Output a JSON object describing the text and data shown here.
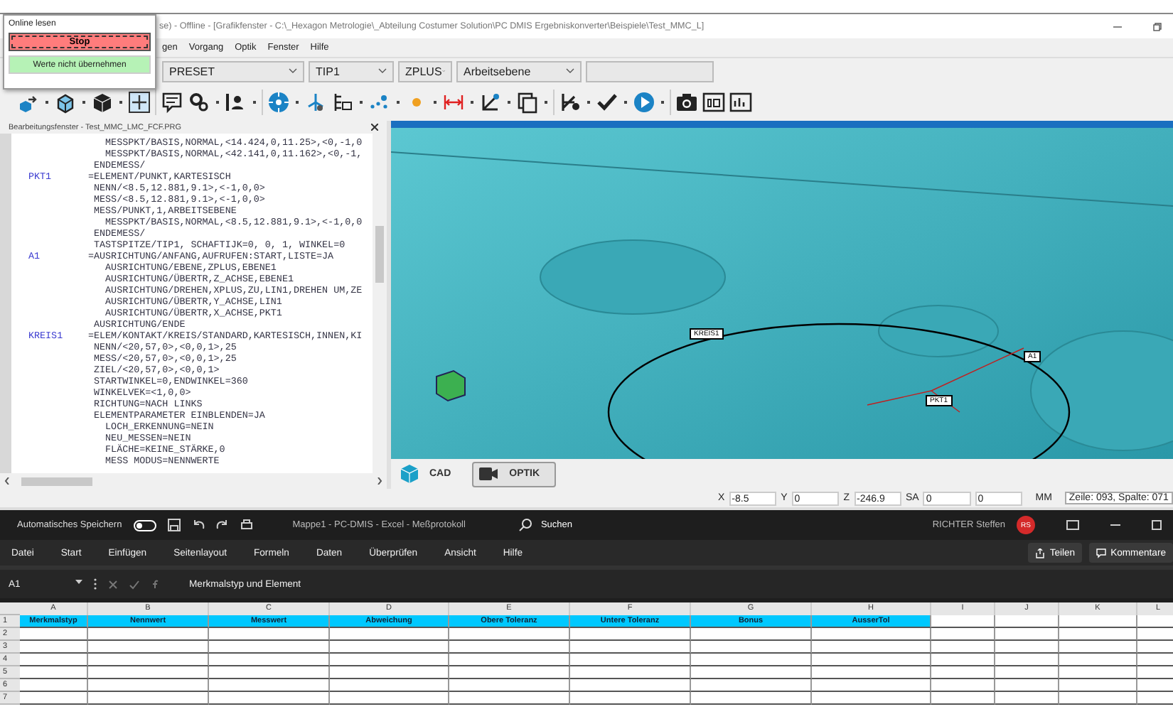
{
  "popup": {
    "label": "Online lesen",
    "stop_button": "Stop",
    "discard_button": "Werte nicht übernehmen"
  },
  "window": {
    "title": "se) - Offline - [Grafikfenster - C:\\_Hexagon Metrologie\\_Abteilung Costumer Solution\\PC DMIS Ergebniskonverter\\Beispiele\\Test_MMC_L]"
  },
  "menu": [
    "gen",
    "Vorgang",
    "Optik",
    "Fenster",
    "Hilfe"
  ],
  "combos": [
    "PRESET",
    "TIP1",
    "ZPLUS",
    "Arbeitsebene"
  ],
  "editor": {
    "title": "Bearbeitungsfenster - Test_MMC_LMC_FCF.PRG",
    "lines": [
      {
        "code": "   MESSPKT/BASIS,NORMAL,<14.424,0,11.25>,<0,-1,0"
      },
      {
        "code": "   MESSPKT/BASIS,NORMAL,<42.141,0,11.162>,<0,-1,"
      },
      {
        "code": " ENDEMESS/"
      },
      {
        "label": "PKT1",
        "code": "=ELEMENT/PUNKT,KARTESISCH"
      },
      {
        "code": " NENN/<8.5,12.881,9.1>,<-1,0,0>"
      },
      {
        "code": " MESS/<8.5,12.881,9.1>,<-1,0,0>"
      },
      {
        "code": " MESS/PUNKT,1,ARBEITSEBENE"
      },
      {
        "code": "   MESSPKT/BASIS,NORMAL,<8.5,12.881,9.1>,<-1,0,0"
      },
      {
        "code": " ENDEMESS/"
      },
      {
        "code": " TASTSPITZE/TIP1, SCHAFTIJK=0, 0, 1, WINKEL=0"
      },
      {
        "label": "A1",
        "code": "=AUSRICHTUNG/ANFANG,AUFRUFEN:START,LISTE=JA"
      },
      {
        "code": "   AUSRICHTUNG/EBENE,ZPLUS,EBENE1"
      },
      {
        "code": "   AUSRICHTUNG/ÜBERTR,Z_ACHSE,EBENE1"
      },
      {
        "code": "   AUSRICHTUNG/DREHEN,XPLUS,ZU,LIN1,DREHEN UM,ZE"
      },
      {
        "code": "   AUSRICHTUNG/ÜBERTR,Y_ACHSE,LIN1"
      },
      {
        "code": "   AUSRICHTUNG/ÜBERTR,X_ACHSE,PKT1"
      },
      {
        "code": " AUSRICHTUNG/ENDE"
      },
      {
        "label": "KREIS1",
        "code": "=ELEM/KONTAKT/KREIS/STANDARD,KARTESISCH,INNEN,KI"
      },
      {
        "code": " NENN/<20,57,0>,<0,0,1>,25"
      },
      {
        "code": " MESS/<20,57,0>,<0,0,1>,25"
      },
      {
        "code": " ZIEL/<20,57,0>,<0,0,1>"
      },
      {
        "code": " STARTWINKEL=0,ENDWINKEL=360"
      },
      {
        "code": " WINKELVEK=<1,0,0>"
      },
      {
        "code": " RICHTUNG=NACH LINKS"
      },
      {
        "code": " ELEMENTPARAMETER EINBLENDEN=JA"
      },
      {
        "code": "   LOCH_ERKENNUNG=NEIN"
      },
      {
        "code": "   NEU_MESSEN=NEIN"
      },
      {
        "code": "   FLÄCHE=KEINE_STÄRKE,0"
      },
      {
        "code": "   MESS MODUS=NENNWERTE"
      }
    ]
  },
  "view": {
    "labels": [
      "KREIS1",
      "A1",
      "PKT1"
    ]
  },
  "view_tabs": [
    {
      "label": "CAD",
      "selected": false
    },
    {
      "label": "OPTIK",
      "selected": true
    }
  ],
  "status": {
    "fields": [
      {
        "label": "X",
        "value": "-8.5"
      },
      {
        "label": "Y",
        "value": "0"
      },
      {
        "label": "Z",
        "value": "-246.9"
      },
      {
        "label": "SA",
        "value": "0"
      },
      {
        "value": "0"
      }
    ],
    "unit": "MM",
    "position": "Zeile: 093, Spalte: 071"
  },
  "excel": {
    "autosave": {
      "label": "Automatisches Speichern",
      "on": false
    },
    "title": "Mappe1 - PC-DMIS - Excel - Meßprotokoll",
    "search": "Suchen",
    "user": "RICHTER Steffen",
    "avatar": "RS",
    "ribbon_tabs": [
      "Datei",
      "Start",
      "Einfügen",
      "Seitenlayout",
      "Formeln",
      "Daten",
      "Überprüfen",
      "Ansicht",
      "Hilfe"
    ],
    "share_button": "Teilen",
    "comments_button": "Kommentare",
    "name_box": "A1",
    "formula": "Merkmalstyp und Element",
    "columns": [
      "A",
      "B",
      "C",
      "D",
      "E",
      "F",
      "G",
      "H",
      "I",
      "J",
      "K",
      "L"
    ],
    "row_numbers": [
      "1",
      "2",
      "3",
      "4",
      "5",
      "6",
      "7"
    ],
    "header_row": [
      "Merkmalstyp",
      "Nennwert",
      "Messwert",
      "Abweichung",
      "Obere Toleranz",
      "Untere Toleranz",
      "Bonus",
      "AusserTol"
    ]
  }
}
